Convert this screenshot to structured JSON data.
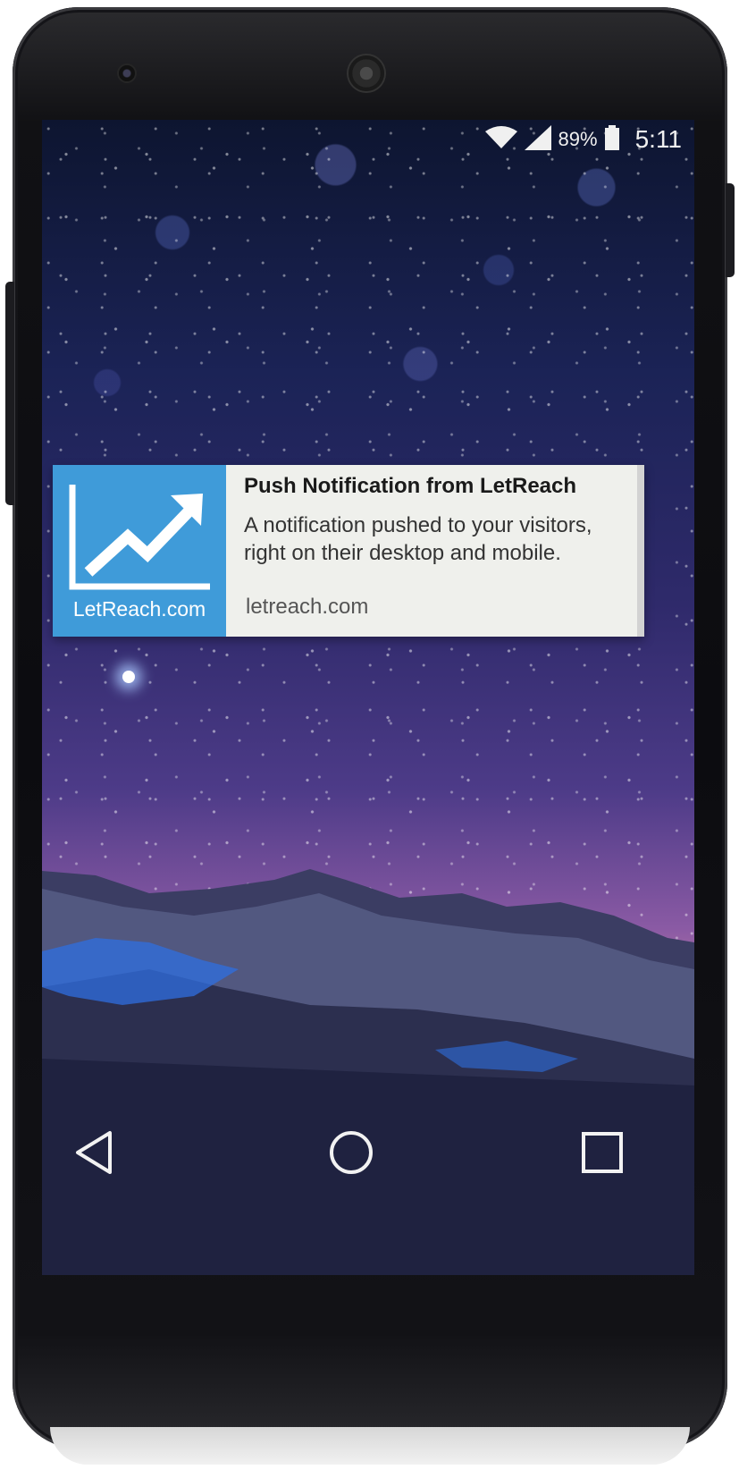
{
  "status_bar": {
    "wifi_icon": "wifi-icon",
    "signal_icon": "signal-icon",
    "battery_percent": "89%",
    "battery_icon": "battery-icon",
    "time": "5:11"
  },
  "notification": {
    "icon_brand": "LetReach.com",
    "icon_name": "trending-up-chart-icon",
    "title": "Push Notification from LetReach",
    "body_line1": "A notification pushed to your visitors,",
    "body_line2": "right on their desktop and mobile.",
    "url": "letreach.com"
  },
  "navigation": {
    "back_icon": "back-icon",
    "home_icon": "home-icon",
    "recent_icon": "recent-apps-icon"
  },
  "colors": {
    "notification_accent": "#3f9bd9",
    "notification_background": "#eff0ec"
  }
}
